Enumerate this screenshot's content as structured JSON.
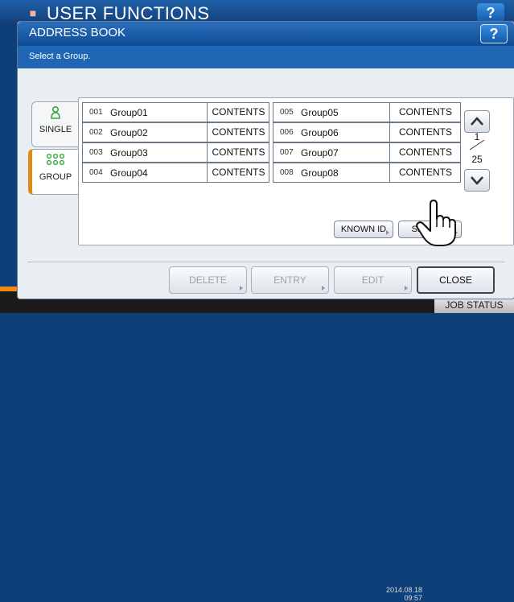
{
  "app": {
    "title": "USER FUNCTIONS",
    "help_label": "?",
    "time_date": "2014.08.18",
    "time_clock": "09:57",
    "job_status_label": "JOB STATUS"
  },
  "dialog": {
    "title": "ADDRESS BOOK",
    "help_label": "?",
    "instruction": "Select a Group."
  },
  "tabs": [
    {
      "label": "SINGLE",
      "icon": "single-person-icon",
      "selected": false
    },
    {
      "label": "GROUP",
      "icon": "group-people-icon",
      "selected": true
    }
  ],
  "groups": [
    {
      "num": "001",
      "name": "Group01",
      "contents_label": "CONTENTS"
    },
    {
      "num": "002",
      "name": "Group02",
      "contents_label": "CONTENTS"
    },
    {
      "num": "003",
      "name": "Group03",
      "contents_label": "CONTENTS"
    },
    {
      "num": "004",
      "name": "Group04",
      "contents_label": "CONTENTS"
    },
    {
      "num": "005",
      "name": "Group05",
      "contents_label": "CONTENTS"
    },
    {
      "num": "006",
      "name": "Group06",
      "contents_label": "CONTENTS"
    },
    {
      "num": "007",
      "name": "Group07",
      "contents_label": "CONTENTS"
    },
    {
      "num": "008",
      "name": "Group08",
      "contents_label": "CONTENTS"
    }
  ],
  "pagination": {
    "current": "1",
    "total": "25"
  },
  "list_buttons": {
    "known_id": "KNOWN ID",
    "search": "SEARCH"
  },
  "footer_buttons": {
    "delete": "DELETE",
    "entry": "ENTRY",
    "edit": "EDIT",
    "close": "CLOSE"
  },
  "colors": {
    "title_bar": "#1f5fa8",
    "instruction_bar": "#1f66b5",
    "group_tab_accent": "#e08a18",
    "icon_green": "#35a83a",
    "status_bar": "#f08a12"
  }
}
